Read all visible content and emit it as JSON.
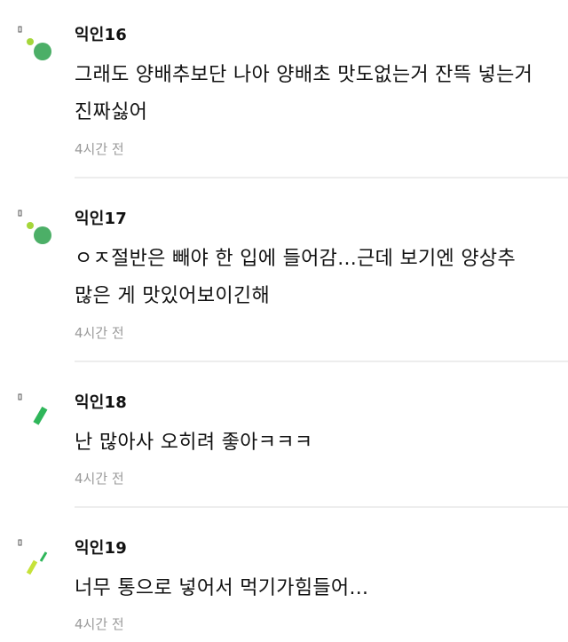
{
  "comments": [
    {
      "author": "익인16",
      "text": "그래도 양배추보단 나아 양배초 맛도없는거 잔뜩 넣는거 진짜싫어",
      "time": "4시간 전",
      "avatar_icon": "green-dots-icon"
    },
    {
      "author": "익인17",
      "text": "ㅇㅈ절반은 빼야 한 입에 들어감...근데 보기엔 양상추 많은 게 맛있어보이긴해",
      "time": "4시간 전",
      "avatar_icon": "green-dots-icon"
    },
    {
      "author": "익인18",
      "text": "난 많아사 오히려 좋아ㅋㅋㅋ",
      "time": "4시간 전",
      "avatar_icon": "green-bar-icon"
    },
    {
      "author": "익인19",
      "text": "너무 통으로 넣어서 먹기가힘들어...",
      "time": "4시간 전",
      "avatar_icon": "green-slashes-icon"
    }
  ],
  "colors": {
    "avatar_green": "#4caf67",
    "avatar_lime": "#a5d63a",
    "avatar_dark": "#555555",
    "timestamp": "#9a9a9a",
    "divider": "#ededed"
  }
}
